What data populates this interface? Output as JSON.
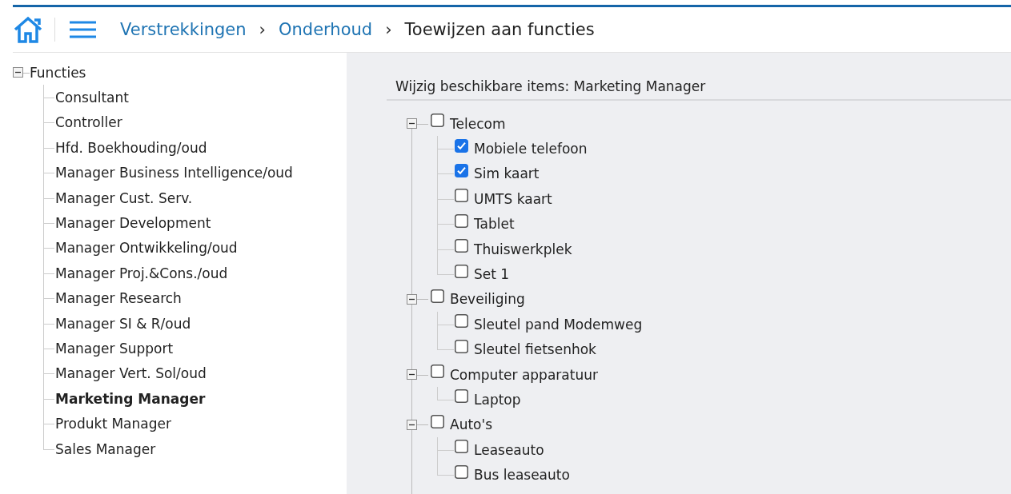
{
  "breadcrumb": [
    {
      "label": "Verstrekkingen",
      "kind": "link"
    },
    {
      "label": "Onderhoud",
      "kind": "link"
    },
    {
      "label": "Toewijzen aan functies",
      "kind": "current"
    }
  ],
  "separator": "›",
  "functions_tree": {
    "label": "Functies",
    "expanded": true,
    "children": [
      {
        "label": "Consultant",
        "selected": false
      },
      {
        "label": "Controller",
        "selected": false
      },
      {
        "label": "Hfd. Boekhouding/oud",
        "selected": false
      },
      {
        "label": "Manager Business Intelligence/oud",
        "selected": false
      },
      {
        "label": "Manager Cust. Serv.",
        "selected": false
      },
      {
        "label": "Manager Development",
        "selected": false
      },
      {
        "label": "Manager Ontwikkeling/oud",
        "selected": false
      },
      {
        "label": "Manager Proj.&Cons./oud",
        "selected": false
      },
      {
        "label": "Manager Research",
        "selected": false
      },
      {
        "label": "Manager SI & R/oud",
        "selected": false
      },
      {
        "label": "Manager Support",
        "selected": false
      },
      {
        "label": "Manager Vert. Sol/oud",
        "selected": false
      },
      {
        "label": "Marketing Manager",
        "selected": true
      },
      {
        "label": "Produkt Manager",
        "selected": false
      },
      {
        "label": "Sales Manager",
        "selected": false
      }
    ]
  },
  "items_panel": {
    "title": "Wijzig beschikbare items: Marketing Manager",
    "groups": [
      {
        "label": "Telecom",
        "checked": false,
        "expanded": true,
        "children": [
          {
            "label": "Mobiele telefoon",
            "checked": true
          },
          {
            "label": "Sim kaart",
            "checked": true
          },
          {
            "label": "UMTS kaart",
            "checked": false
          },
          {
            "label": "Tablet",
            "checked": false
          },
          {
            "label": "Thuiswerkplek",
            "checked": false
          },
          {
            "label": "Set 1",
            "checked": false
          }
        ]
      },
      {
        "label": "Beveiliging",
        "checked": false,
        "expanded": true,
        "children": [
          {
            "label": "Sleutel pand Modemweg",
            "checked": false
          },
          {
            "label": "Sleutel fietsenhok",
            "checked": false
          }
        ]
      },
      {
        "label": "Computer apparatuur",
        "checked": false,
        "expanded": true,
        "children": [
          {
            "label": "Laptop",
            "checked": false
          }
        ]
      },
      {
        "label": "Auto's",
        "checked": false,
        "expanded": true,
        "children": [
          {
            "label": "Leaseauto",
            "checked": false
          },
          {
            "label": "Bus leaseauto",
            "checked": false
          }
        ]
      }
    ]
  }
}
